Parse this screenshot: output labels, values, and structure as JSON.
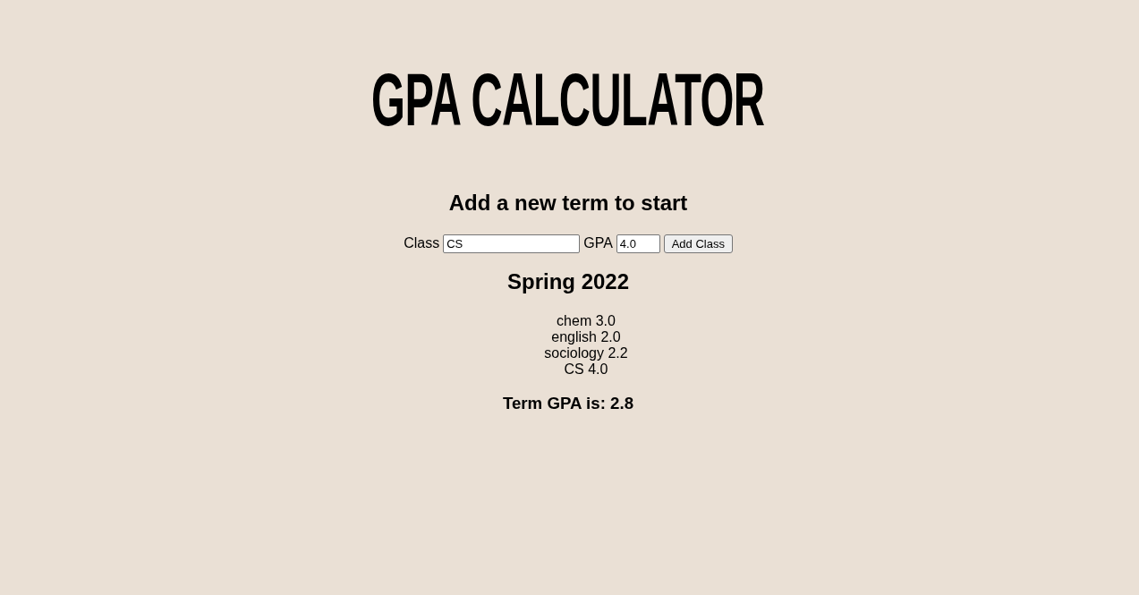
{
  "title": "GPA CALCULATOR",
  "prompt": "Add a new term to start",
  "form": {
    "class_label": "Class",
    "class_value": "CS",
    "gpa_label": "GPA",
    "gpa_value": "4.0",
    "button": "Add Class"
  },
  "term": {
    "name": "Spring 2022",
    "classes": [
      "chem 3.0",
      "english 2.0",
      "sociology 2.2",
      "CS 4.0"
    ],
    "summary": "Term GPA is: 2.8"
  }
}
